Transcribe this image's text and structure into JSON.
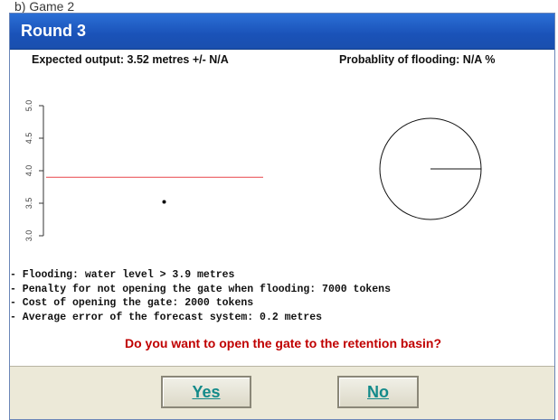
{
  "caption": "b) Game 2",
  "window": {
    "title": "Round 3"
  },
  "expected_output": "Expected output: 3.52 metres  +/- N/A",
  "probability_label": "Probablity of flooding: N/A %",
  "chart_data": {
    "type": "scatter",
    "y_ticks": [
      "3.0",
      "3.5",
      "4.0",
      "4.5",
      "5.0"
    ],
    "ylim": [
      3.0,
      5.0
    ],
    "threshold": 3.9,
    "threshold_color": "#e8454a",
    "points": [
      {
        "x": 0.5,
        "y": 3.52
      }
    ]
  },
  "rules": [
    "- Flooding: water level > 3.9 metres",
    "- Penalty for not opening the gate when flooding: 7000 tokens",
    "- Cost of opening the gate: 2000 tokens",
    "- Average error of the forecast system: 0.2 metres"
  ],
  "question": "Do you want to open the gate to the retention basin?",
  "buttons": {
    "yes": "Yes",
    "no": "No"
  }
}
